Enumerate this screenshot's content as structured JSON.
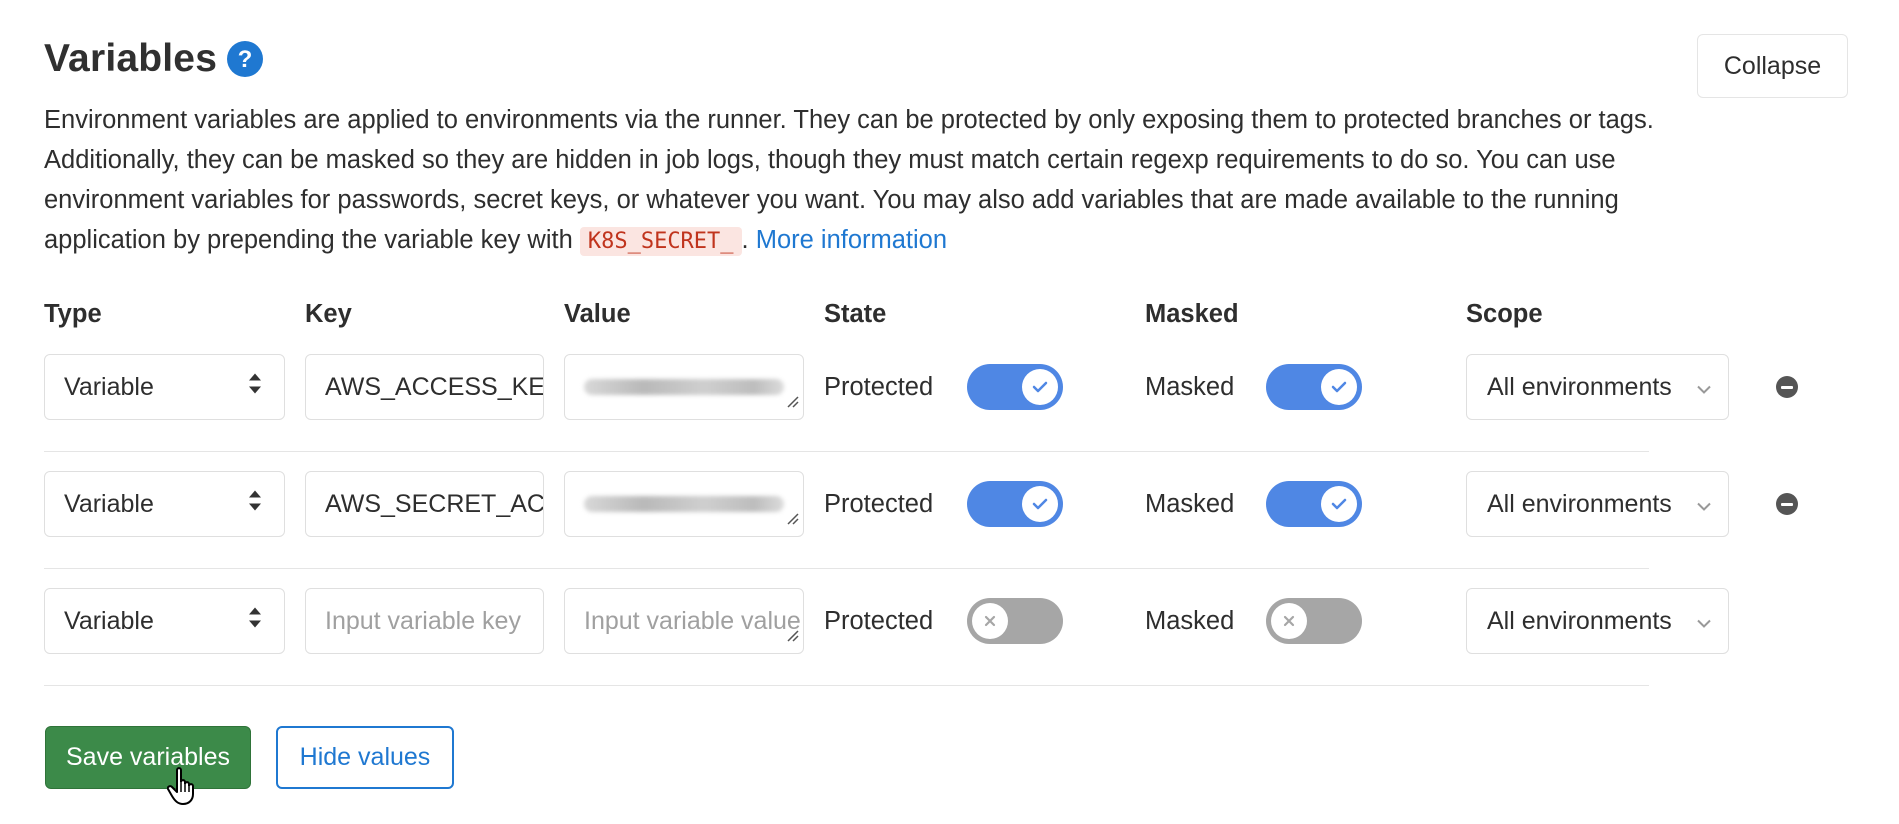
{
  "section": {
    "title": "Variables",
    "collapse_label": "Collapse",
    "description_text": "Environment variables are applied to environments via the runner. They can be protected by only exposing them to protected branches or tags. Additionally, they can be masked so they are hidden in job logs, though they must match certain regexp requirements to do so. You can use environment variables for passwords, secret keys, or whatever you want. You may also add variables that are made available to the running application by prepending the variable key with ",
    "description_code": "K8S_SECRET_",
    "description_after_code": ". ",
    "more_info_link": "More information"
  },
  "columns": {
    "type": "Type",
    "key": "Key",
    "value": "Value",
    "state": "State",
    "masked": "Masked",
    "scope": "Scope"
  },
  "rows": [
    {
      "type": "Variable",
      "key": "AWS_ACCESS_KEY_ID",
      "value_masked": true,
      "value_placeholder": "",
      "state_label": "Protected",
      "protected": true,
      "masked_label": "Masked",
      "masked": true,
      "scope": "All environments",
      "removable": true
    },
    {
      "type": "Variable",
      "key": "AWS_SECRET_ACCESS_KEY",
      "value_masked": true,
      "value_placeholder": "",
      "state_label": "Protected",
      "protected": true,
      "masked_label": "Masked",
      "masked": true,
      "scope": "All environments",
      "removable": true
    },
    {
      "type": "Variable",
      "key": "",
      "key_placeholder": "Input variable key",
      "value_masked": false,
      "value_placeholder": "Input variable value",
      "state_label": "Protected",
      "protected": false,
      "masked_label": "Masked",
      "masked": false,
      "scope": "All environments",
      "removable": false
    }
  ],
  "actions": {
    "save_label": "Save variables",
    "hide_label": "Hide values"
  },
  "colors": {
    "link": "#1f78d1",
    "toggle_on": "#4f87e4",
    "toggle_off": "#a6a6a6",
    "save_button": "#3c8a49",
    "code_text": "#c0341d",
    "code_bg": "#fbe5e1"
  },
  "icons": {
    "help": "question-circle-icon",
    "select_arrows": "sort-arrows-icon",
    "scope_dropdown": "chevron-down-icon",
    "remove": "minus-circle-icon",
    "toggle_on": "check-icon",
    "toggle_off": "close-icon",
    "cursor": "hand-pointer-icon"
  }
}
